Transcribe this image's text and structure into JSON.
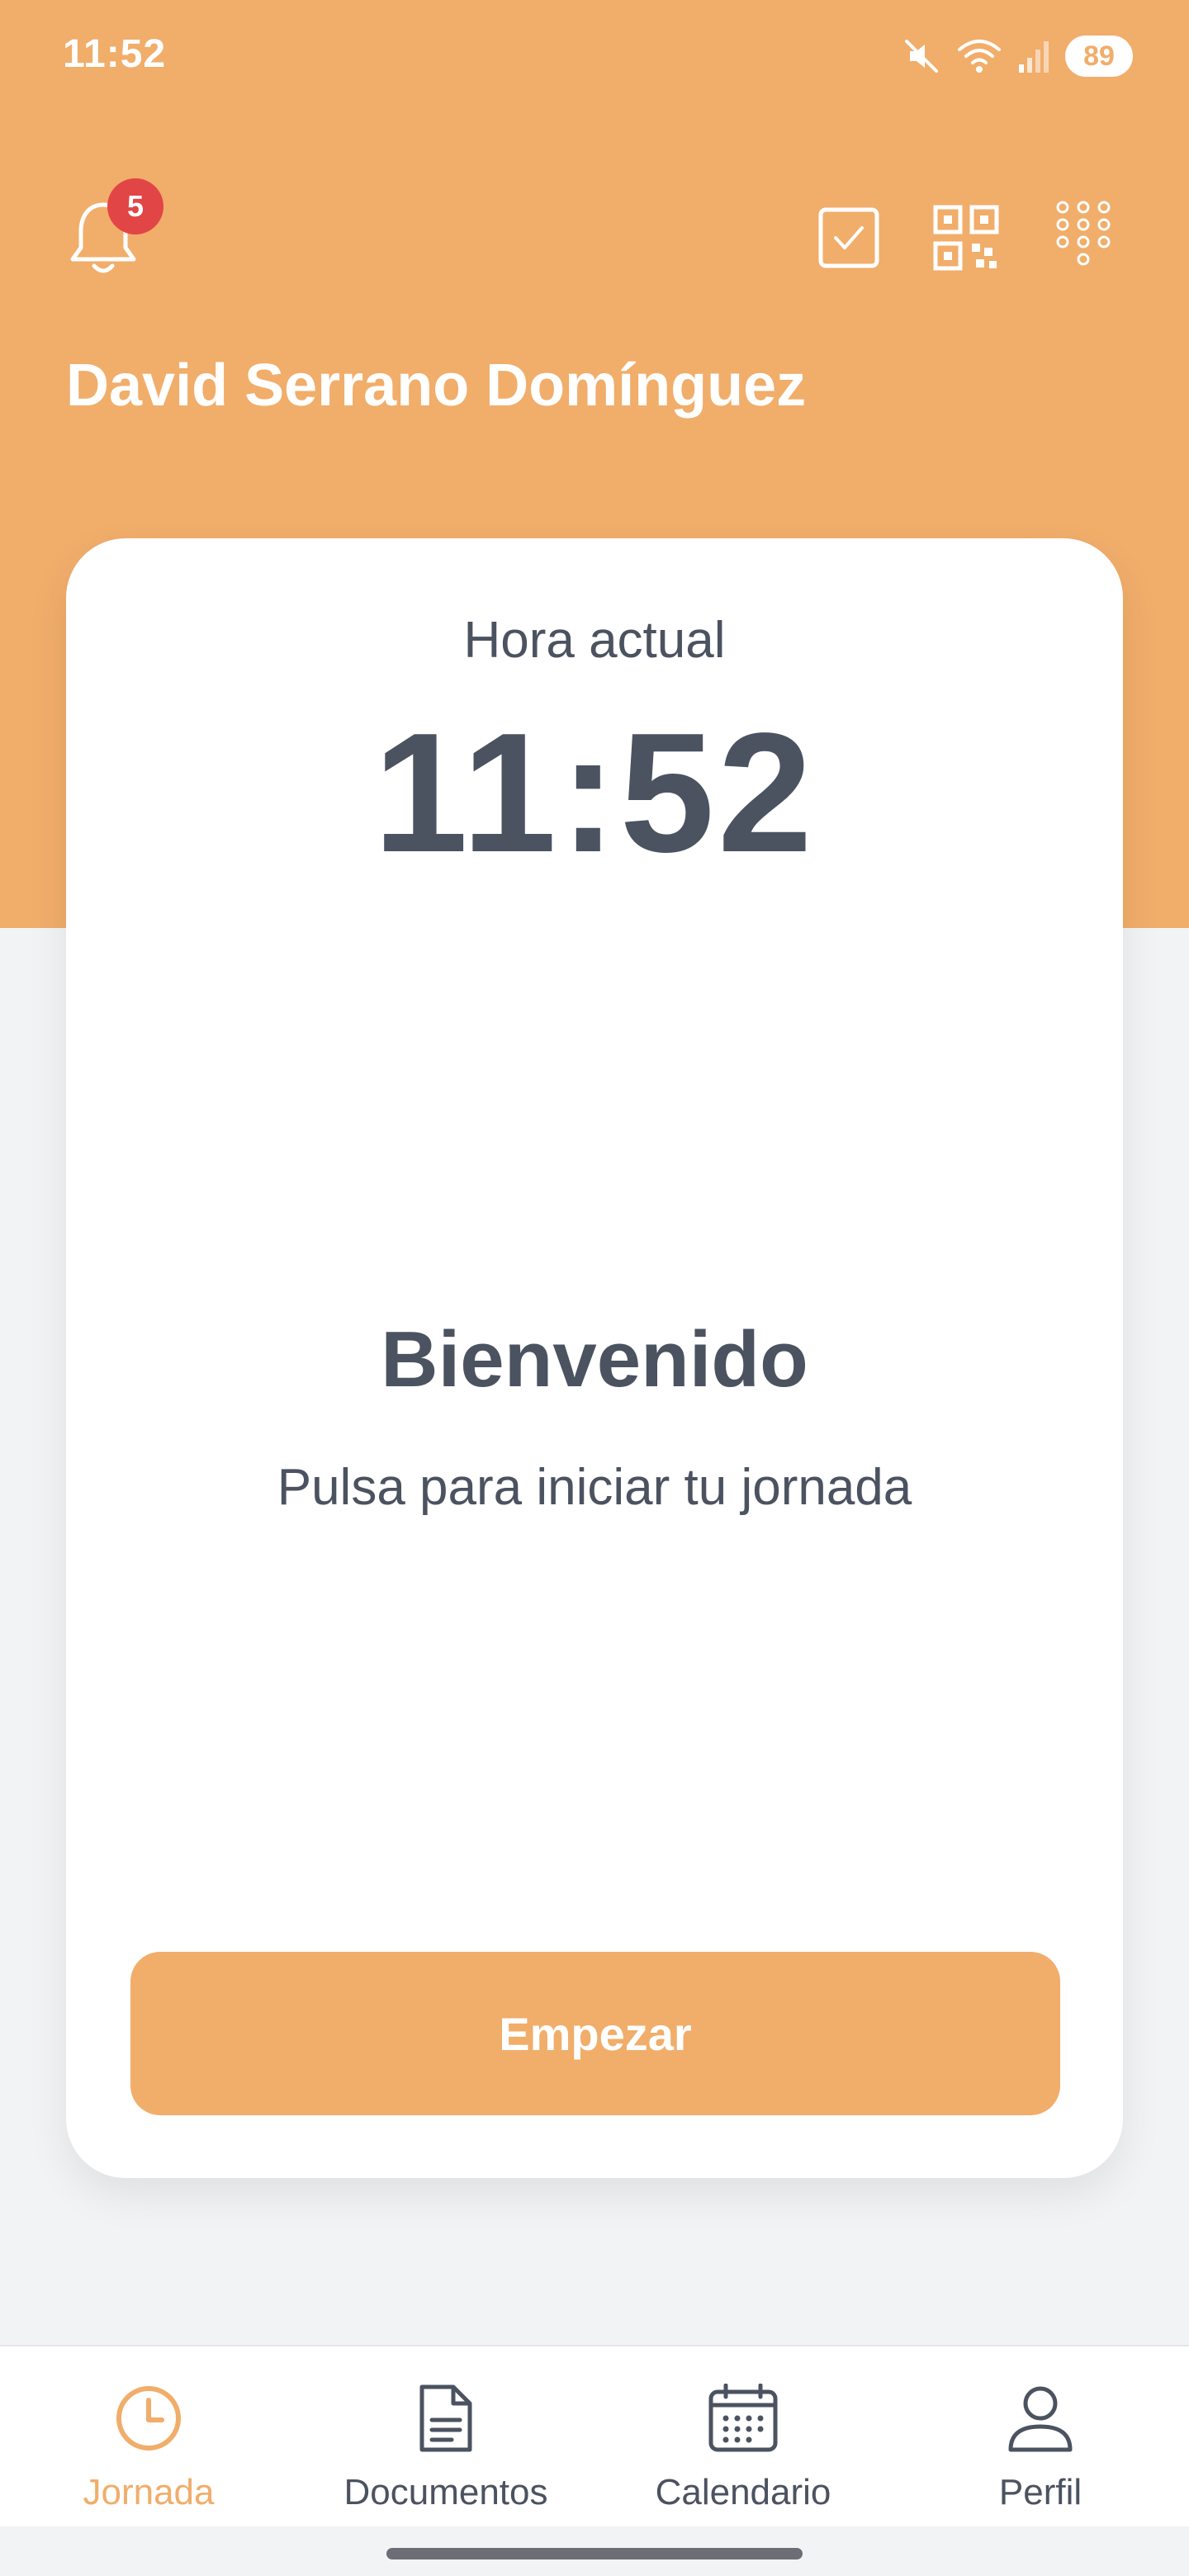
{
  "status_bar": {
    "time": "11:52",
    "battery": "89"
  },
  "header": {
    "notification_count": "5",
    "user_name": "David Serrano Domínguez",
    "actions": [
      "checkbox-icon",
      "qr-code-icon",
      "keypad-icon"
    ]
  },
  "card": {
    "current_time_label": "Hora actual",
    "current_time": "11:52",
    "welcome_title": "Bienvenido",
    "welcome_subtitle": "Pulsa para iniciar tu jornada",
    "start_button": "Empezar"
  },
  "bottom_nav": {
    "items": [
      {
        "label": "Jornada",
        "icon": "clock-icon",
        "active": true
      },
      {
        "label": "Documentos",
        "icon": "document-icon",
        "active": false
      },
      {
        "label": "Calendario",
        "icon": "calendar-icon",
        "active": false
      },
      {
        "label": "Perfil",
        "icon": "user-icon",
        "active": false
      }
    ]
  },
  "colors": {
    "accent": "#f1ad6a",
    "text": "#4b5260",
    "badge": "#e24545"
  }
}
